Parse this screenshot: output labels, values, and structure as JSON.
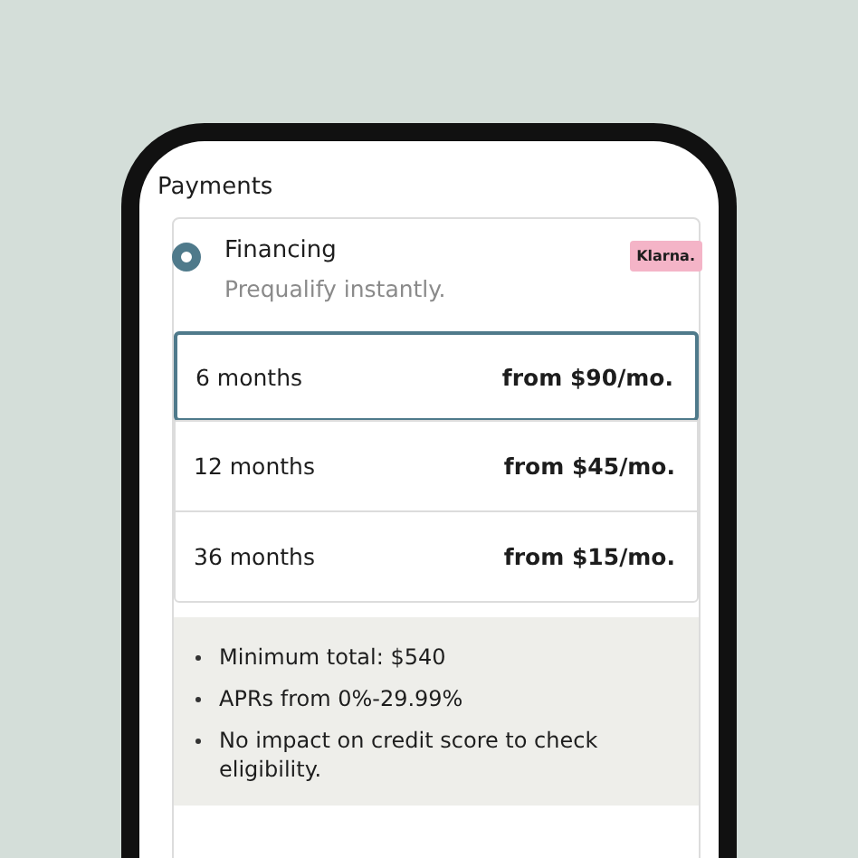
{
  "section_title": "Payments",
  "payment_option": {
    "title": "Financing",
    "subtitle": "Prequalify instantly.",
    "selected": true,
    "badge": "Klarna."
  },
  "plans": [
    {
      "term": "6 months",
      "price": "from $90/mo.",
      "selected": true
    },
    {
      "term": "12 months",
      "price": "from $45/mo.",
      "selected": false
    },
    {
      "term": "36 months",
      "price": "from $15/mo.",
      "selected": false
    }
  ],
  "details": [
    "Minimum total: $540",
    "APRs from 0%-29.99%",
    "No impact on credit score to check eligibility."
  ]
}
